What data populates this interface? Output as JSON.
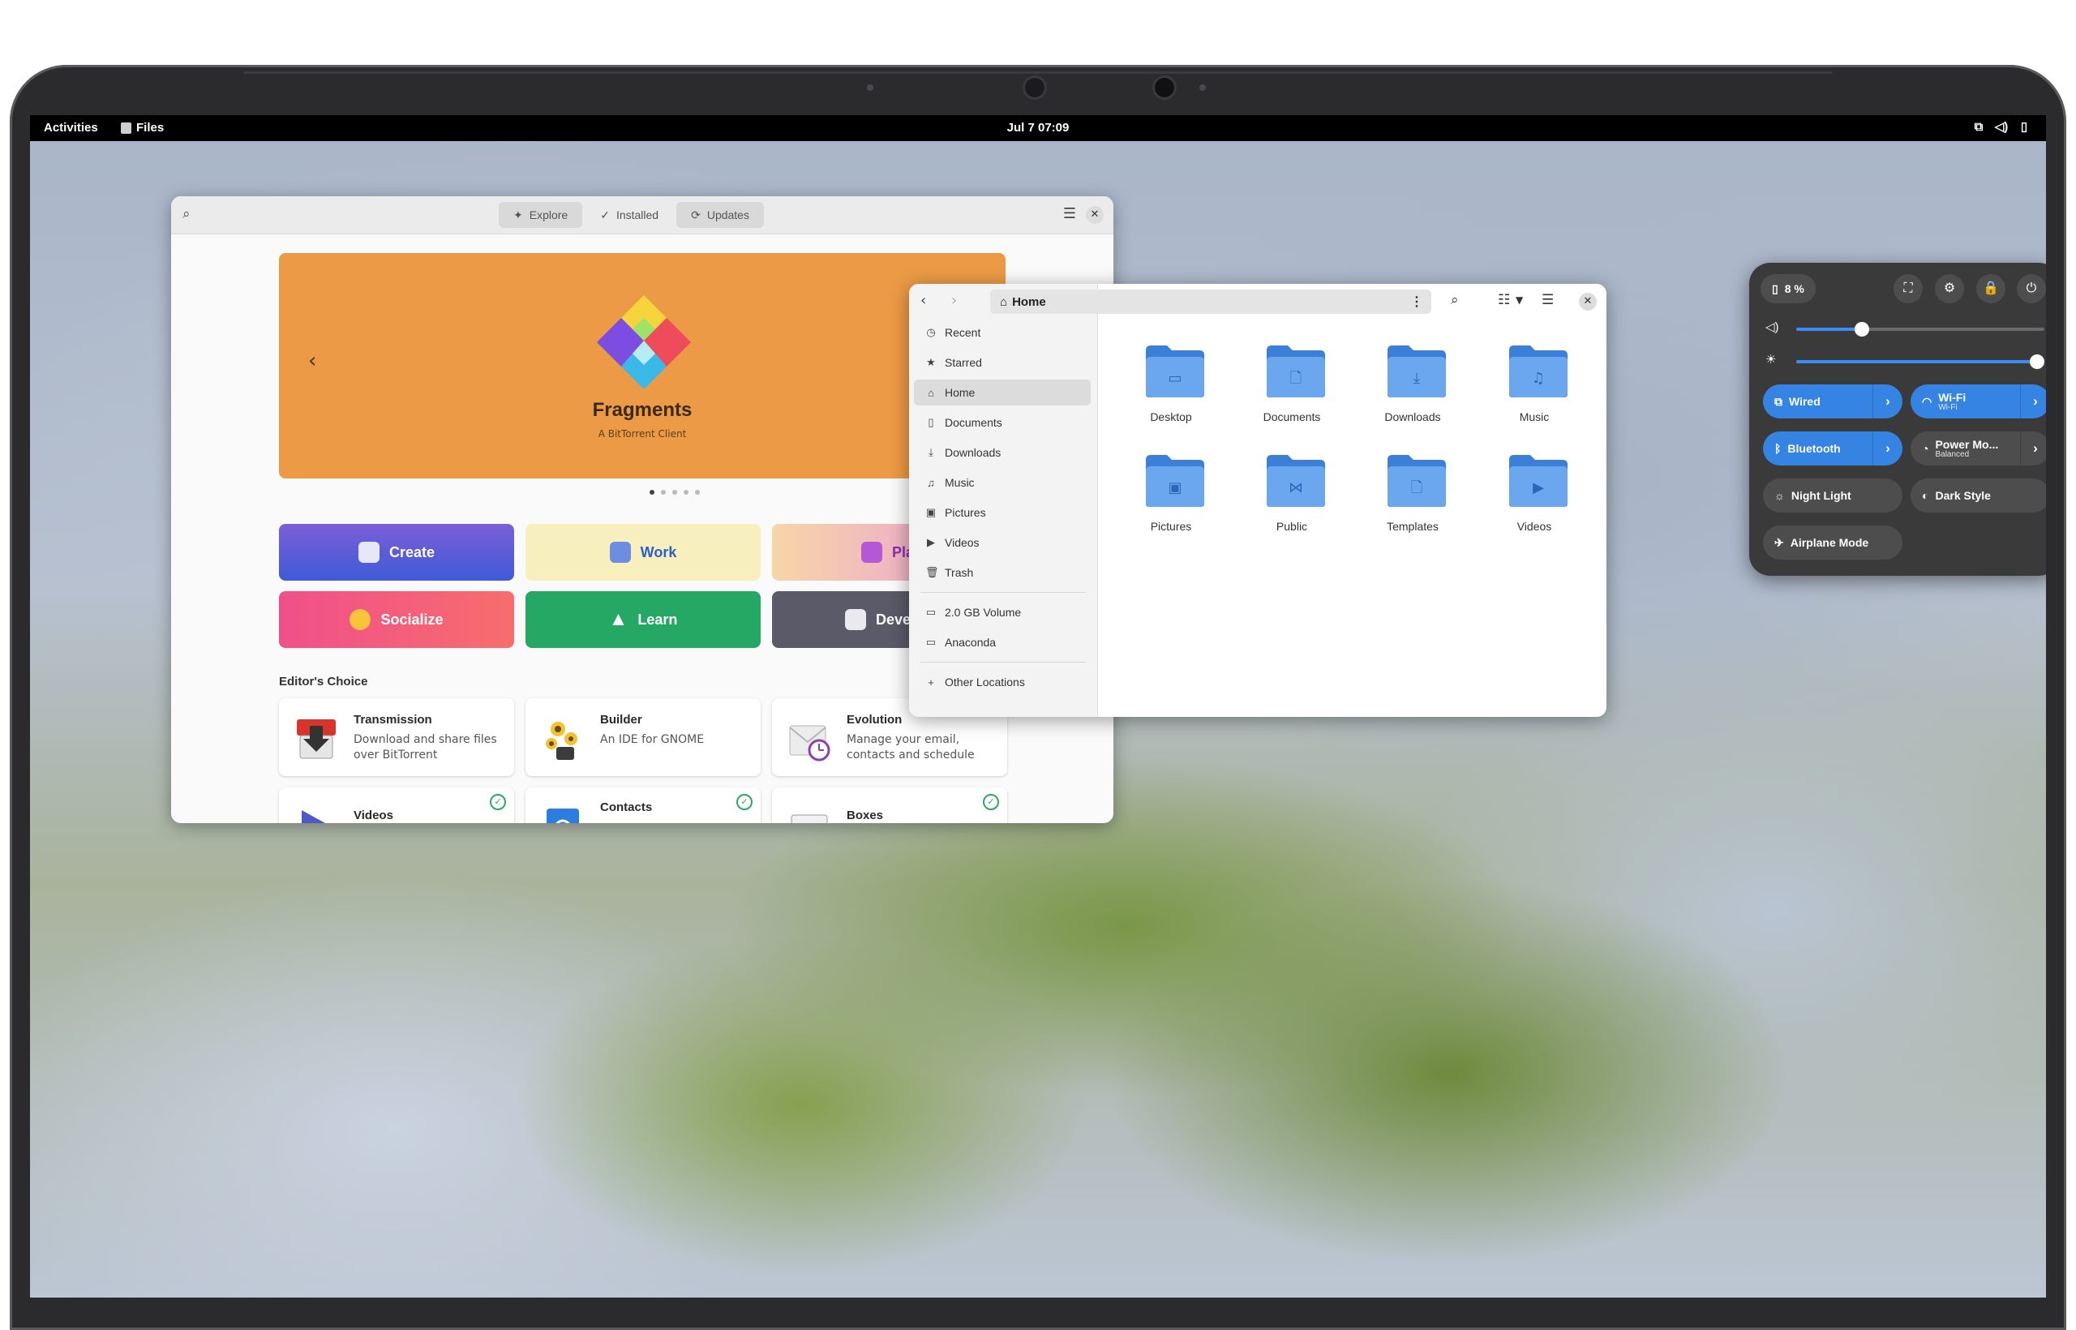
{
  "topbar": {
    "activities": "Activities",
    "app_name": "Files",
    "clock": "Jul 7  07:09",
    "tray_icons": [
      "network-icon",
      "volume-icon",
      "battery-icon"
    ]
  },
  "software": {
    "tabs": [
      {
        "label": "Explore",
        "icon": "sparkle-icon"
      },
      {
        "label": "Installed",
        "icon": "check-icon"
      },
      {
        "label": "Updates",
        "icon": "refresh-icon"
      }
    ],
    "banner": {
      "title": "Fragments",
      "subtitle": "A BitTorrent Client",
      "color": "#ec9a45"
    },
    "page_dots": 5,
    "categories": [
      {
        "label": "Create",
        "color": "#5e56d6"
      },
      {
        "label": "Work",
        "color": "#f7efbe"
      },
      {
        "label": "Play",
        "color": "#f2a5c3"
      },
      {
        "label": "Socialize",
        "color": "#f25a7e"
      },
      {
        "label": "Learn",
        "color": "#26a865"
      },
      {
        "label": "Develop",
        "color": "#5a5a68"
      }
    ],
    "section_title": "Editor's Choice",
    "cards": [
      {
        "name": "Transmission",
        "desc": "Download and share files over BitTorrent",
        "installed": false
      },
      {
        "name": "Builder",
        "desc": "An IDE for GNOME",
        "installed": false
      },
      {
        "name": "Evolution",
        "desc": "Manage your email, contacts and schedule",
        "installed": false
      },
      {
        "name": "Videos",
        "desc": "",
        "installed": true
      },
      {
        "name": "Contacts",
        "desc": "",
        "installed": true
      },
      {
        "name": "Boxes",
        "desc": "",
        "installed": true
      }
    ]
  },
  "files": {
    "path": "Home",
    "sidebar": [
      {
        "label": "Recent",
        "icon": "clock-icon"
      },
      {
        "label": "Starred",
        "icon": "star-icon"
      },
      {
        "label": "Home",
        "icon": "home-icon",
        "selected": true
      },
      {
        "label": "Documents",
        "icon": "document-icon"
      },
      {
        "label": "Downloads",
        "icon": "download-icon"
      },
      {
        "label": "Music",
        "icon": "music-icon"
      },
      {
        "label": "Pictures",
        "icon": "picture-icon"
      },
      {
        "label": "Videos",
        "icon": "video-icon"
      },
      {
        "label": "Trash",
        "icon": "trash-icon"
      }
    ],
    "drives": [
      {
        "label": "2.0 GB Volume",
        "icon": "drive-icon"
      },
      {
        "label": "Anaconda",
        "icon": "drive-icon"
      }
    ],
    "other": {
      "label": "Other Locations",
      "icon": "plus-icon"
    },
    "folders": [
      {
        "label": "Desktop",
        "glyph": "▭"
      },
      {
        "label": "Documents",
        "glyph": "🗋"
      },
      {
        "label": "Downloads",
        "glyph": "⤓"
      },
      {
        "label": "Music",
        "glyph": "♫"
      },
      {
        "label": "Pictures",
        "glyph": "▣"
      },
      {
        "label": "Public",
        "glyph": "⋈"
      },
      {
        "label": "Templates",
        "glyph": "🗋"
      },
      {
        "label": "Videos",
        "glyph": "▶"
      }
    ],
    "folder_color": "#4a90e2"
  },
  "quick_settings": {
    "battery": "8 %",
    "volume_level": 0.25,
    "brightness_level": 1.0,
    "accent": "#3584e4",
    "toggles": [
      {
        "label": "Wired",
        "sub": "",
        "on": true,
        "arrow": true,
        "icon": "network-icon"
      },
      {
        "label": "Wi-Fi",
        "sub": "Wi-Fi",
        "on": true,
        "arrow": true,
        "icon": "wifi-icon"
      },
      {
        "label": "Bluetooth",
        "sub": "",
        "on": true,
        "arrow": true,
        "icon": "bluetooth-icon"
      },
      {
        "label": "Power Mo...",
        "sub": "Balanced",
        "on": false,
        "arrow": true,
        "icon": "power-mode-icon"
      },
      {
        "label": "Night Light",
        "sub": "",
        "on": false,
        "arrow": false,
        "icon": "sun-icon"
      },
      {
        "label": "Dark Style",
        "sub": "",
        "on": false,
        "arrow": false,
        "icon": "contrast-icon"
      },
      {
        "label": "Airplane Mode",
        "sub": "",
        "on": false,
        "arrow": false,
        "icon": "airplane-icon"
      }
    ]
  }
}
